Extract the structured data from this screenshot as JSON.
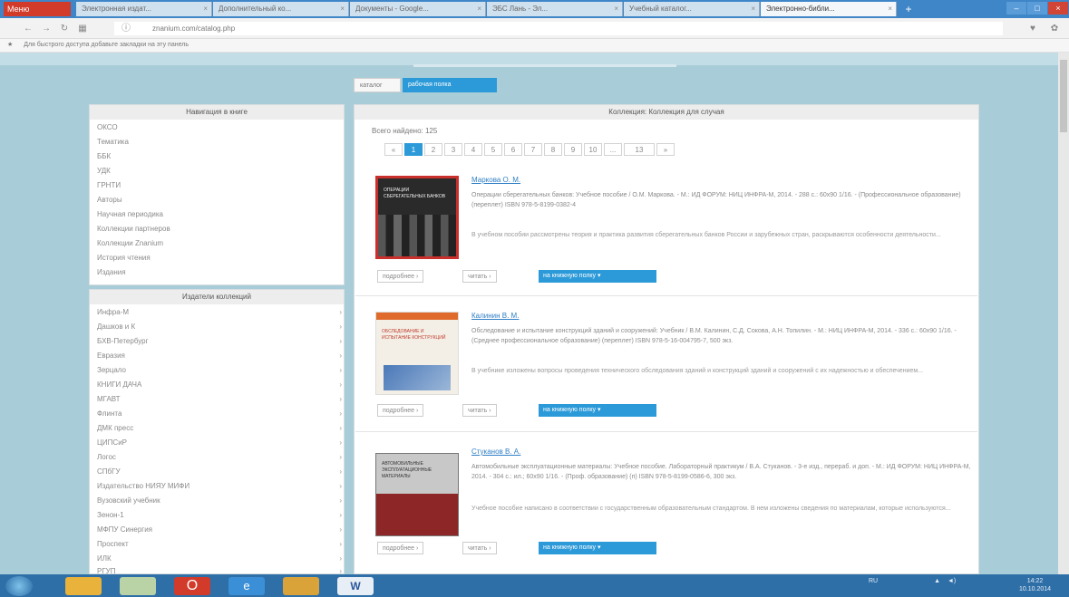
{
  "browser": {
    "menu_label": "Меню",
    "tabs": [
      {
        "label": "Электронная издат..."
      },
      {
        "label": "Дополнительный ко..."
      },
      {
        "label": "Документы - Google..."
      },
      {
        "label": "ЭБС Лань - Эл..."
      },
      {
        "label": "Учебный каталог..."
      },
      {
        "label": "Электронно-библи..."
      }
    ],
    "url": "znanium.com/catalog.php",
    "bookmarks_hint": "Для быстрого доступа добавьте закладки на эту панель"
  },
  "page_tabs": {
    "inactive": "каталог",
    "active": "рабочая полка"
  },
  "navigation": {
    "title": "Навигация в книге",
    "items": [
      "ОКСО",
      "Тематика",
      "ББК",
      "УДК",
      "ГРНТИ",
      "Авторы",
      "Научная периодика",
      "Коллекции партнеров",
      "Коллекции Znanium",
      "История чтения",
      "Издания"
    ]
  },
  "collections": {
    "title": "Издатели коллекций",
    "items": [
      "Инфра-М",
      "Дашков и К",
      "БХВ-Петербург",
      "Евразия",
      "Зерцало",
      "КНИГИ ДАЧА",
      "МГАВТ",
      "Флинта",
      "ДМК пресс",
      "ЦИПСиР",
      "Логос",
      "СПбГУ",
      "Издательство НИЯУ МИФИ",
      "Вузовский учебник",
      "Зенон-1",
      "МФПУ Синергия",
      "Проспект",
      "ИЛК",
      "РГУП"
    ],
    "arrow": "›"
  },
  "main": {
    "header": "Коллекция: Коллекция для случая",
    "total": "Всего найдено: 125",
    "pagination": [
      "«",
      "1",
      "2",
      "3",
      "4",
      "5",
      "6",
      "7",
      "8",
      "9",
      "10",
      "...",
      "13",
      "»"
    ],
    "books": [
      {
        "author": "Маркова О. М.",
        "description": "Операции сберегательных банков: Учебное пособие / О.М. Маркова. - М.: ИД ФОРУМ: НИЦ ИНФРА-М, 2014. - 288 с.: 60x90 1/16. - (Профессиональное образование) (переплет) ISBN 978-5-8199-0382-4",
        "annotation": "В учебном пособии рассмотрены теория и практика развития сберегательных банков России и зарубежных стран, раскрываются особенности деятельности...",
        "cover_title": "ОПЕРАЦИИ СБЕРЕГАТЕЛЬНЫХ БАНКОВ",
        "btn_more": "подробнее",
        "btn_read": "читать",
        "btn_shelf": "на книжную полку"
      },
      {
        "author": "Калинин В. М.",
        "description": "Обследование и испытание конструкций зданий и сооружений: Учебник / В.М. Калинин, С.Д. Сокова, А.Н. Топилин. - М.: НИЦ ИНФРА-М, 2014. - 336 с.: 60x90 1/16. - (Среднее профессиональное образование) (переплет) ISBN 978-5-16-004795-7, 500 экз.",
        "annotation": "В учебнике изложены вопросы проведения технического обследования зданий и конструкций зданий и сооружений с их надежностью и обеспечением...",
        "cover_title": "ОБСЛЕДОВАНИЕ И ИСПЫТАНИЕ КОНСТРУКЦИЙ",
        "btn_more": "подробнее",
        "btn_read": "читать",
        "btn_shelf": "на книжную полку"
      },
      {
        "author": "Стуканов В. А.",
        "description": "Автомобильные эксплуатационные материалы: Учебное пособие. Лабораторный практикум / В.А. Стуканов. - 3-e изд., перераб. и доп. - М.: ИД ФОРУМ: НИЦ ИНФРА-М, 2014. - 304 с.: ил.; 60x90 1/16. - (Проф. образование) (п) ISBN 978-5-8199-0586-6, 300 экз.",
        "annotation": "Учебное пособие написано в соответствии с государственным образовательным стандартом. В нем изложены сведения по материалам, которые используются...",
        "cover_title": "АВТОМОБИЛЬНЫЕ ЭКСПЛУАТАЦИОННЫЕ МАТЕРИАЛЫ",
        "btn_more": "подробнее",
        "btn_read": "читать",
        "btn_shelf": "на книжную полку"
      }
    ]
  },
  "taskbar": {
    "apps": [
      "start",
      "explorer",
      "files",
      "opera",
      "ie",
      "chrome",
      "word"
    ],
    "lang": "RU",
    "time": "14:22",
    "date": "10.10.2014"
  },
  "colors": {
    "accent": "#2c9ad8",
    "link": "#2f7fc5",
    "page_bg": "#a9cdd8",
    "taskbar": "#2e6fa8"
  }
}
